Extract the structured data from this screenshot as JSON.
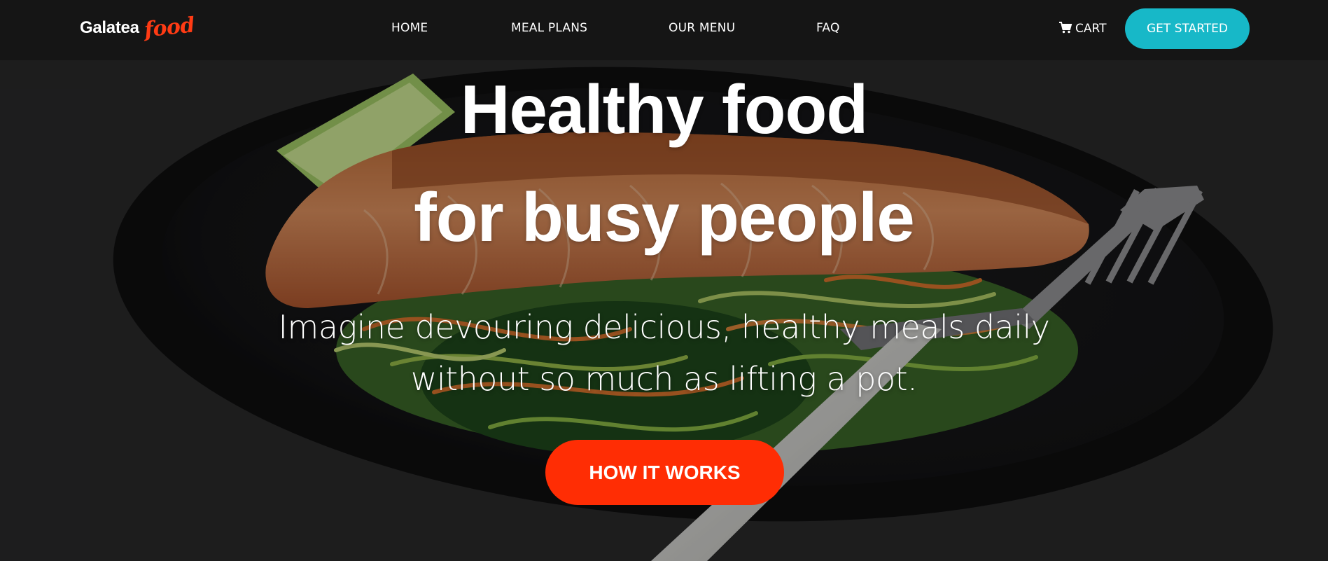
{
  "logo": {
    "main": "Galatea",
    "accent": "food"
  },
  "nav": {
    "items": [
      {
        "label": "HOME"
      },
      {
        "label": "MEAL PLANS"
      },
      {
        "label": "OUR MENU"
      },
      {
        "label": "FAQ"
      }
    ],
    "cart_label": "CART",
    "cta_label": "GET STARTED"
  },
  "hero": {
    "headline_line1": "Healthy food",
    "headline_line2": "for busy people",
    "subtext_line1": "Imagine devouring delicious, healthy meals daily",
    "subtext_line2": "without so much as lifting a pot.",
    "button_label": "HOW IT WORKS"
  },
  "colors": {
    "accent_red": "#ff2d04",
    "accent_teal": "#17b8c8",
    "nav_background": "#151515"
  },
  "icons": {
    "cart": "shopping-cart-icon"
  }
}
